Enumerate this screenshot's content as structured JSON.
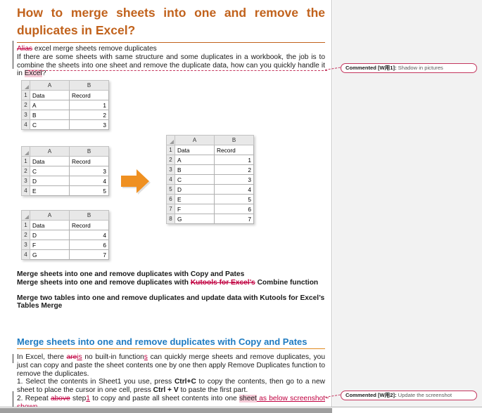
{
  "document": {
    "title_line1": "How to merge sheets into one and remove the",
    "title_line2": "duplicates in Excel?",
    "alias_deleted": "Alias",
    "alias_text": " excel merge sheets remove duplicates",
    "intro_p1": "If there are some sheets with same structure and some duplicates in a workbook, the job is to combine the sheets into one sheet and remove the duplicate data, how can you quickly handle it in ",
    "intro_highlight": "Excel",
    "intro_tail": "?",
    "bold_line1": "Merge sheets into one and remove duplicates with Copy and Pates",
    "bold_line2_pre": "Merge sheets into one and remove duplicates with ",
    "bold_line2_del": "Kutools for Excel’s",
    "bold_line2_post": " Combine function",
    "bold_line3": "Merge two tables into one and remove duplicates and update data with Kutools for Excel’s Tables Merge",
    "blue_heading": "Merge sheets into one and remove duplicates with Copy and Pates",
    "para2_a": "In Excel, there ",
    "para2_del1": "are",
    "para2_ins1": "is",
    "para2_b": " no built-in function",
    "para2_ins2": "s",
    "para2_c": " can quickly merge sheets and remove duplicates, you just can copy and paste the sheet contents one by one then apply Remove Duplicates function to remove the duplicates.",
    "step1_a": "1. Select the contents in Sheet1 you use, press ",
    "step1_b1": "Ctrl+C",
    "step1_c": " to copy the contents, then go to a new sheet to place the cursor in one cell, press ",
    "step1_b2": "Ctrl + V",
    "step1_d": " to paste the first part.",
    "step2_a": "2. Repeat ",
    "step2_del": "above",
    "step2_b": " step",
    "step2_ins1": "1",
    "step2_c": " to copy and paste all sheet contents into one ",
    "step2_hl": "sheet",
    "step2_ins2": " as below screenshot shown",
    "step2_tail": "."
  },
  "tables": {
    "column_headers": [
      "A",
      "B"
    ],
    "header_row": [
      "Data",
      "Record"
    ],
    "sheet1": {
      "row_numbers": [
        "1",
        "2",
        "3",
        "4"
      ],
      "rows": [
        [
          "A",
          "1"
        ],
        [
          "B",
          "2"
        ],
        [
          "C",
          "3"
        ]
      ]
    },
    "sheet2": {
      "row_numbers": [
        "1",
        "2",
        "3",
        "4"
      ],
      "rows": [
        [
          "C",
          "3"
        ],
        [
          "D",
          "4"
        ],
        [
          "E",
          "5"
        ]
      ]
    },
    "sheet3": {
      "row_numbers": [
        "1",
        "2",
        "3",
        "4"
      ],
      "rows": [
        [
          "D",
          "4"
        ],
        [
          "F",
          "6"
        ],
        [
          "G",
          "7"
        ]
      ]
    },
    "result": {
      "row_numbers": [
        "1",
        "2",
        "3",
        "4",
        "5",
        "6",
        "7",
        "8"
      ],
      "rows": [
        [
          "A",
          "1"
        ],
        [
          "B",
          "2"
        ],
        [
          "C",
          "3"
        ],
        [
          "D",
          "4"
        ],
        [
          "E",
          "5"
        ],
        [
          "F",
          "6"
        ],
        [
          "G",
          "7"
        ]
      ]
    }
  },
  "comments": [
    {
      "tag": "Commented [W用1]:",
      "text": " Shadow in pictures"
    },
    {
      "tag": "Commented [W用2]:",
      "text": " Update the screenshot"
    }
  ],
  "colors": {
    "title": "#c1621c",
    "heading_blue": "#1f7bc1",
    "heading_rule": "#e08a1e",
    "tracked_change": "#c00040",
    "arrow": "#ef9021",
    "comment_border": "#c4365e"
  },
  "icons": {
    "arrow": "merge-arrow-icon"
  }
}
